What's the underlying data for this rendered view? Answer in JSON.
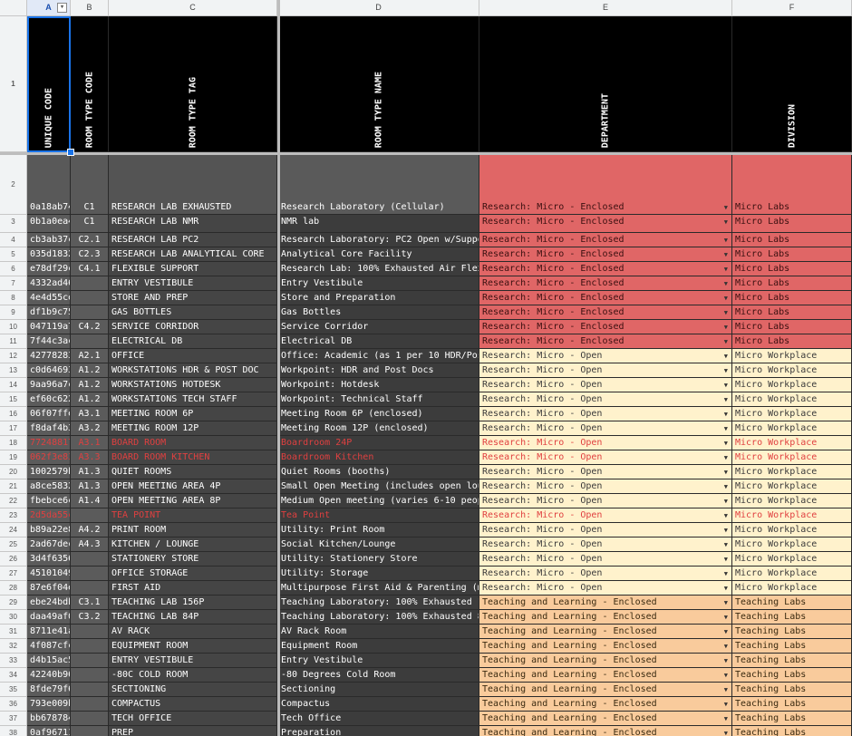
{
  "columns": [
    {
      "letter": "A",
      "header": "UNIQUE CODE"
    },
    {
      "letter": "B",
      "header": "ROOM TYPE CODE"
    },
    {
      "letter": "C",
      "header": "ROOM TYPE TAG"
    },
    {
      "letter": "D",
      "header": "ROOM TYPE NAME"
    },
    {
      "letter": "E",
      "header": "DEPARTMENT"
    },
    {
      "letter": "F",
      "header": "DIVISION"
    }
  ],
  "header_row_number": "1",
  "rows": [
    {
      "n": "2",
      "a": "0a18ab74",
      "b": "C1",
      "c": "RESEARCH LAB EXHAUSTED",
      "d": "Research Laboratory (Cellular)",
      "e": "Research: Micro - Enclosed",
      "f": "Micro Labs",
      "tone": "red",
      "hl": false
    },
    {
      "n": "3",
      "a": "0b1a0ea4",
      "b": "C1",
      "c": "RESEARCH LAB NMR",
      "d": "NMR lab",
      "e": "Research: Micro - Enclosed",
      "f": "Micro Labs",
      "tone": "red",
      "hl": false
    },
    {
      "n": "4",
      "a": "cb3ab37c",
      "b": "C2.1",
      "c": "RESEARCH LAB PC2",
      "d": "Research Laboratory: PC2 Open w/Suppo",
      "e": "Research: Micro - Enclosed",
      "f": "Micro Labs",
      "tone": "red",
      "hl": false
    },
    {
      "n": "5",
      "a": "035d1832",
      "b": "C2.3",
      "c": "RESEARCH LAB ANALYTICAL CORE",
      "d": "Analytical Core Facility",
      "e": "Research: Micro - Enclosed",
      "f": "Micro Labs",
      "tone": "red",
      "hl": false
    },
    {
      "n": "6",
      "a": "e78df29c",
      "b": "C4.1",
      "c": "FLEXIBLE SUPPORT",
      "d": "Research Lab: 100% Exhausted Air Flex",
      "e": "Research: Micro - Enclosed",
      "f": "Micro Labs",
      "tone": "red",
      "hl": false
    },
    {
      "n": "7",
      "a": "4332ad46",
      "b": "",
      "c": "ENTRY VESTIBULE",
      "d": "Entry Vestibule",
      "e": "Research: Micro - Enclosed",
      "f": "Micro Labs",
      "tone": "red",
      "hl": false
    },
    {
      "n": "8",
      "a": "4e4d55ce",
      "b": "",
      "c": "STORE AND PREP",
      "d": "Store and Preparation",
      "e": "Research: Micro - Enclosed",
      "f": "Micro Labs",
      "tone": "red",
      "hl": false
    },
    {
      "n": "9",
      "a": "df1b9c75",
      "b": "",
      "c": "GAS BOTTLES",
      "d": "Gas Bottles",
      "e": "Research: Micro - Enclosed",
      "f": "Micro Labs",
      "tone": "red",
      "hl": false
    },
    {
      "n": "10",
      "a": "047119a7",
      "b": "C4.2",
      "c": "SERVICE CORRIDOR",
      "d": "Service Corridor",
      "e": "Research: Micro - Enclosed",
      "f": "Micro Labs",
      "tone": "red",
      "hl": false
    },
    {
      "n": "11",
      "a": "7f44c3ac",
      "b": "",
      "c": "ELECTRICAL DB",
      "d": "Electrical DB",
      "e": "Research: Micro - Enclosed",
      "f": "Micro Labs",
      "tone": "red",
      "hl": false
    },
    {
      "n": "12",
      "a": "42778283",
      "b": "A2.1",
      "c": "OFFICE",
      "d": "Office: Academic (as 1 per 10 HDR/Pos",
      "e": "Research: Micro - Open",
      "f": "Micro Workplace",
      "tone": "ylw",
      "hl": false
    },
    {
      "n": "13",
      "a": "c0d64693",
      "b": "A1.2",
      "c": "WORKSTATIONS HDR & POST DOC",
      "d": "Workpoint: HDR and Post Docs",
      "e": "Research: Micro - Open",
      "f": "Micro Workplace",
      "tone": "ylw",
      "hl": false
    },
    {
      "n": "14",
      "a": "9aa96a7c",
      "b": "A1.2",
      "c": "WORKSTATIONS HOTDESK",
      "d": "Workpoint: Hotdesk",
      "e": "Research: Micro - Open",
      "f": "Micro Workplace",
      "tone": "ylw",
      "hl": false
    },
    {
      "n": "15",
      "a": "ef60c622",
      "b": "A1.2",
      "c": "WORKSTATIONS TECH STAFF",
      "d": "Workpoint: Technical Staff",
      "e": "Research: Micro - Open",
      "f": "Micro Workplace",
      "tone": "ylw",
      "hl": false
    },
    {
      "n": "16",
      "a": "06f07ffe",
      "b": "A3.1",
      "c": "MEETING ROOM 6P",
      "d": "Meeting Room 6P (enclosed)",
      "e": "Research: Micro - Open",
      "f": "Micro Workplace",
      "tone": "ylw",
      "hl": false
    },
    {
      "n": "17",
      "a": "f8daf4b3",
      "b": "A3.2",
      "c": "MEETING ROOM 12P",
      "d": "Meeting Room 12P (enclosed)",
      "e": "Research: Micro - Open",
      "f": "Micro Workplace",
      "tone": "ylw",
      "hl": false
    },
    {
      "n": "18",
      "a": "77248817",
      "b": "A3.1",
      "c": "BOARD ROOM",
      "d": "Boardroom 24P",
      "e": "Research: Micro - Open",
      "f": "Micro Workplace",
      "tone": "ylw",
      "hl": true
    },
    {
      "n": "19",
      "a": "062f3e83",
      "b": "A3.3",
      "c": "BOARD ROOM KITCHEN",
      "d": "Boardroom Kitchen",
      "e": "Research: Micro - Open",
      "f": "Micro Workplace",
      "tone": "ylw",
      "hl": true
    },
    {
      "n": "20",
      "a": "1002579b",
      "b": "A1.3",
      "c": "QUIET ROOMS",
      "d": "Quiet Rooms (booths)",
      "e": "Research: Micro - Open",
      "f": "Micro Workplace",
      "tone": "ylw",
      "hl": false
    },
    {
      "n": "21",
      "a": "a8ce5832",
      "b": "A1.3",
      "c": "OPEN MEETING AREA 4P",
      "d": "Small Open Meeting (includes open lou",
      "e": "Research: Micro - Open",
      "f": "Micro Workplace",
      "tone": "ylw",
      "hl": false
    },
    {
      "n": "22",
      "a": "fbebce6c",
      "b": "A1.4",
      "c": "OPEN MEETING AREA 8P",
      "d": "Medium Open meeting (varies 6-10 peop",
      "e": "Research: Micro - Open",
      "f": "Micro Workplace",
      "tone": "ylw",
      "hl": false
    },
    {
      "n": "23",
      "a": "2d5da55c",
      "b": "",
      "c": "TEA POINT",
      "d": "Tea Point",
      "e": "Research: Micro - Open",
      "f": "Micro Workplace",
      "tone": "ylw",
      "hl": true
    },
    {
      "n": "24",
      "a": "b89a22e8",
      "b": "A4.2",
      "c": "PRINT ROOM",
      "d": "Utility: Print Room",
      "e": "Research: Micro - Open",
      "f": "Micro Workplace",
      "tone": "ylw",
      "hl": false
    },
    {
      "n": "25",
      "a": "2ad67dec",
      "b": "A4.3",
      "c": "KITCHEN / LOUNGE",
      "d": "Social Kitchen/Lounge",
      "e": "Research: Micro - Open",
      "f": "Micro Workplace",
      "tone": "ylw",
      "hl": false
    },
    {
      "n": "26",
      "a": "3d4f6356",
      "b": "",
      "c": "STATIONERY STORE",
      "d": "Utility: Stationery Store",
      "e": "Research: Micro - Open",
      "f": "Micro Workplace",
      "tone": "ylw",
      "hl": false
    },
    {
      "n": "27",
      "a": "45101049",
      "b": "",
      "c": "OFFICE STORAGE",
      "d": "Utility: Storage",
      "e": "Research: Micro - Open",
      "f": "Micro Workplace",
      "tone": "ylw",
      "hl": false
    },
    {
      "n": "28",
      "a": "87e6f04e",
      "b": "",
      "c": "FIRST AID",
      "d": "Multipurpose First Aid & Parenting (m",
      "e": "Research: Micro - Open",
      "f": "Micro Workplace",
      "tone": "ylw",
      "hl": false
    },
    {
      "n": "29",
      "a": "ebe24bdb",
      "b": "C3.1",
      "c": "TEACHING LAB 156P",
      "d": "Teaching Laboratory: 100% Exhausted 1",
      "e": "Teaching and Learning - Enclosed",
      "f": "Teaching Labs",
      "tone": "org",
      "hl": false
    },
    {
      "n": "30",
      "a": "daa49af0",
      "b": "C3.2",
      "c": "TEACHING LAB 84P",
      "d": "Teaching Laboratory: 100% Exhausted 8",
      "e": "Teaching and Learning - Enclosed",
      "f": "Teaching Labs",
      "tone": "org",
      "hl": false
    },
    {
      "n": "31",
      "a": "8711e41a",
      "b": "",
      "c": "AV RACK",
      "d": "AV Rack Room",
      "e": "Teaching and Learning - Enclosed",
      "f": "Teaching Labs",
      "tone": "org",
      "hl": false
    },
    {
      "n": "32",
      "a": "4f087cfc",
      "b": "",
      "c": "EQUIPMENT ROOM",
      "d": "Equipment Room",
      "e": "Teaching and Learning - Enclosed",
      "f": "Teaching Labs",
      "tone": "org",
      "hl": false
    },
    {
      "n": "33",
      "a": "d4b15ac5",
      "b": "",
      "c": "ENTRY VESTIBULE",
      "d": "Entry Vestibule",
      "e": "Teaching and Learning - Enclosed",
      "f": "Teaching Labs",
      "tone": "org",
      "hl": false
    },
    {
      "n": "34",
      "a": "42240b96",
      "b": "",
      "c": "-80C COLD ROOM",
      "d": "-80 Degrees Cold Room",
      "e": "Teaching and Learning - Enclosed",
      "f": "Teaching Labs",
      "tone": "org",
      "hl": false
    },
    {
      "n": "35",
      "a": "8fde79f6",
      "b": "",
      "c": "SECTIONING",
      "d": "Sectioning",
      "e": "Teaching and Learning - Enclosed",
      "f": "Teaching Labs",
      "tone": "org",
      "hl": false
    },
    {
      "n": "36",
      "a": "793e009b",
      "b": "",
      "c": "COMPACTUS",
      "d": "Compactus",
      "e": "Teaching and Learning - Enclosed",
      "f": "Teaching Labs",
      "tone": "org",
      "hl": false
    },
    {
      "n": "37",
      "a": "bb678784",
      "b": "",
      "c": "TECH OFFICE",
      "d": "Tech Office",
      "e": "Teaching and Learning - Enclosed",
      "f": "Teaching Labs",
      "tone": "org",
      "hl": false
    },
    {
      "n": "38",
      "a": "0af96711",
      "b": "",
      "c": "PREP",
      "d": "Preparation",
      "e": "Teaching and Learning - Enclosed",
      "f": "Teaching Labs",
      "tone": "org",
      "hl": false
    }
  ],
  "colors": {
    "red": "#e06666",
    "yellow": "#fff2cc",
    "orange": "#f9cb9c",
    "header_bg": "#000000",
    "selection": "#1a73e8"
  },
  "icons": {
    "dropdown": "dropdown-arrow-icon",
    "filter": "filter-icon"
  }
}
